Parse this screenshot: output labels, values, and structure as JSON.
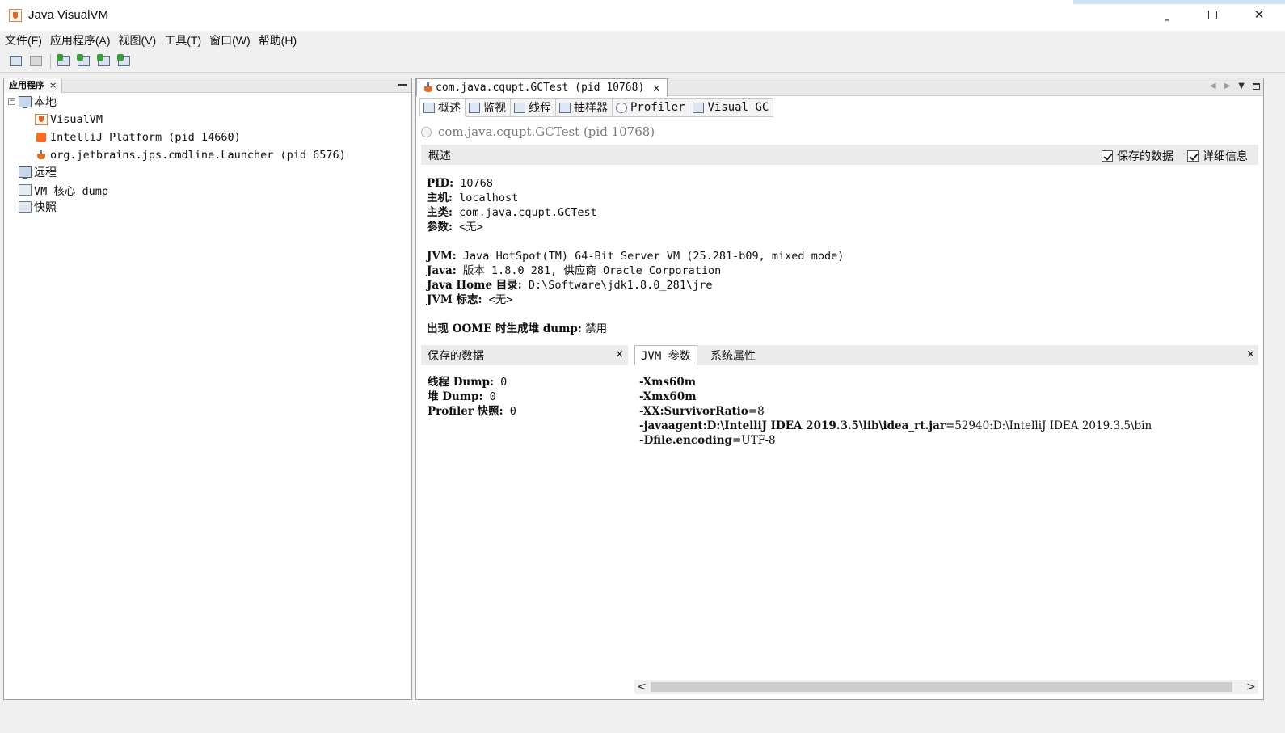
{
  "window": {
    "title": "Java VisualVM",
    "minimize": "ˍ",
    "close": "✕"
  },
  "menu": [
    "文件(F)",
    "应用程序(A)",
    "视图(V)",
    "工具(T)",
    "窗口(W)",
    "帮助(H)"
  ],
  "toolbar": {
    "buttons": [
      "load-snapshot-icon",
      "save-icon",
      "add-host-icon",
      "add-jmx-icon",
      "heap-dump-icon",
      "thread-dump-icon"
    ]
  },
  "left_panel": {
    "tab_label": "应用程序",
    "close": "×",
    "tree": {
      "local": "本地",
      "visualvm": "VisualVM",
      "intellij": "IntelliJ Platform (pid 14660)",
      "launcher": "org.jetbrains.jps.cmdline.Launcher (pid 6576)",
      "remote": "远程",
      "coredump": "VM 核心 dump",
      "snapshots": "快照",
      "collapse_sign": "−"
    }
  },
  "document": {
    "tab_label": "com.java.cqupt.GCTest (pid 10768)",
    "close": "×",
    "subtabs": {
      "overview": "概述",
      "monitor": "监视",
      "threads": "线程",
      "sampler": "抽样器",
      "profiler": "Profiler",
      "visualgc": "Visual GC"
    },
    "process_title": "com.java.cqupt.GCTest",
    "process_pid": "(pid 10768)",
    "section_title": "概述",
    "checkbox_saved": "保存的数据",
    "checkbox_details": "详细信息",
    "info": {
      "pid_label": "PID:",
      "pid_value": " 10768",
      "host_label": "主机:",
      "host_value": " localhost",
      "mainclass_label": "主类:",
      "mainclass_value": " com.java.cqupt.GCTest",
      "args_label": "参数:",
      "args_value": " <无>",
      "jvm_label": "JVM:",
      "jvm_value": " Java HotSpot(TM) 64-Bit Server VM (25.281-b09, mixed mode)",
      "java_label": "Java:",
      "java_value": " 版本 1.8.0_281, 供应商 Oracle Corporation",
      "javahome_label": "Java Home 目录:",
      "javahome_value": " D:\\Software\\jdk1.8.0_281\\jre",
      "flags_label": "JVM 标志:",
      "flags_value": " <无>",
      "oome_label": "出现 OOME 时生成堆 dump:",
      "oome_value": " 禁用"
    },
    "saved_pane": {
      "title": "保存的数据",
      "close": "×",
      "thread_label": "线程 Dump:",
      "thread_value": " 0",
      "heap_label": "堆 Dump:",
      "heap_value": " 0",
      "profiler_label": "Profiler 快照:",
      "profiler_value": " 0"
    },
    "jvm_pane": {
      "tab_jvm_args": "JVM 参数",
      "tab_sys_props": "系统属性",
      "close": "×",
      "args": [
        {
          "key": "-Xms60m",
          "value": ""
        },
        {
          "key": "-Xmx60m",
          "value": ""
        },
        {
          "key": "-XX:SurvivorRatio",
          "value": "=8"
        },
        {
          "key": "-javaagent:D:\\IntelliJ  IDEA  2019.3.5\\lib\\idea_rt.jar",
          "value": "=52940:D:\\IntelliJ  IDEA  2019.3.5\\bin"
        },
        {
          "key": "-Dfile.encoding",
          "value": "=UTF-8"
        }
      ]
    },
    "scroll": {
      "left": "<",
      "right": ">"
    }
  }
}
